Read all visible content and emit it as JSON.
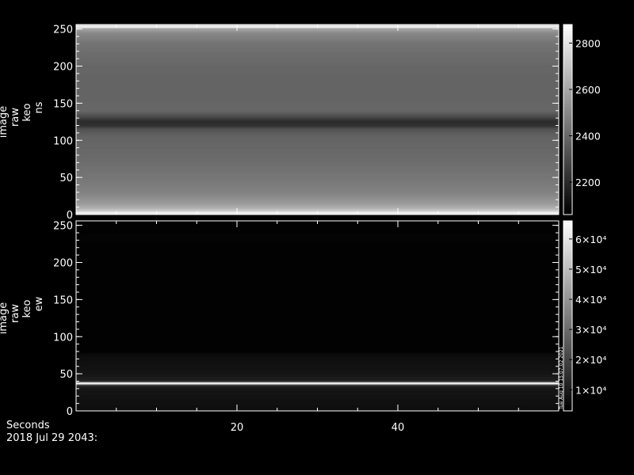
{
  "chart_data": [
    {
      "type": "heatmap",
      "ylabel": [
        "image",
        "raw",
        "keo",
        "ns"
      ],
      "xlim": [
        0,
        60
      ],
      "ylim": [
        0,
        256
      ],
      "x_ticks": [
        20,
        40
      ],
      "y_ticks": [
        0,
        50,
        100,
        150,
        200,
        250
      ],
      "colorbar": {
        "range": [
          2060,
          2880
        ],
        "ticks": [
          {
            "label": "2200",
            "value": 2200
          },
          {
            "label": "2400",
            "value": 2400
          },
          {
            "label": "2600",
            "value": 2600
          },
          {
            "label": "2800",
            "value": 2800
          }
        ]
      },
      "profile": [
        [
          0,
          2750
        ],
        [
          3,
          2850
        ],
        [
          5,
          2720
        ],
        [
          8,
          2650
        ],
        [
          15,
          2560
        ],
        [
          30,
          2480
        ],
        [
          50,
          2440
        ],
        [
          80,
          2400
        ],
        [
          105,
          2380
        ],
        [
          115,
          2330
        ],
        [
          120,
          2220
        ],
        [
          126,
          2200
        ],
        [
          132,
          2300
        ],
        [
          140,
          2390
        ],
        [
          170,
          2380
        ],
        [
          200,
          2390
        ],
        [
          230,
          2430
        ],
        [
          245,
          2500
        ],
        [
          251,
          2600
        ],
        [
          253,
          2880
        ],
        [
          256,
          2700
        ]
      ]
    },
    {
      "type": "heatmap",
      "ylabel": [
        "image",
        "raw",
        "keo",
        "ew"
      ],
      "xlim": [
        0,
        60
      ],
      "ylim": [
        0,
        256
      ],
      "x_ticks": [
        20,
        40
      ],
      "y_ticks": [
        0,
        50,
        100,
        150,
        200,
        250
      ],
      "colorbar": {
        "range": [
          3000,
          66000
        ],
        "ticks": [
          {
            "label": "1×10⁴",
            "value": 10000
          },
          {
            "label": "2×10⁴",
            "value": 20000
          },
          {
            "label": "3×10⁴",
            "value": 30000
          },
          {
            "label": "4×10⁴",
            "value": 40000
          },
          {
            "label": "5×10⁴",
            "value": 50000
          },
          {
            "label": "6×10⁴",
            "value": 60000
          }
        ]
      },
      "side_note": "Tue Aug 10 15:07:02 2021",
      "profile": [
        [
          0,
          6500
        ],
        [
          15,
          7200
        ],
        [
          30,
          8500
        ],
        [
          34,
          12000
        ],
        [
          35.5,
          25000
        ],
        [
          36.5,
          55000
        ],
        [
          37.5,
          66000
        ],
        [
          38.5,
          55000
        ],
        [
          39.5,
          22000
        ],
        [
          41,
          11000
        ],
        [
          50,
          8200
        ],
        [
          62,
          7300
        ],
        [
          75,
          6200
        ],
        [
          80,
          3700
        ],
        [
          120,
          3500
        ],
        [
          200,
          3500
        ],
        [
          225,
          3500
        ],
        [
          230,
          4300
        ],
        [
          236,
          4300
        ],
        [
          240,
          3500
        ],
        [
          256,
          3500
        ]
      ]
    }
  ],
  "xaxis_label": "Seconds",
  "timestamp": "2018 Jul 29 2043:"
}
